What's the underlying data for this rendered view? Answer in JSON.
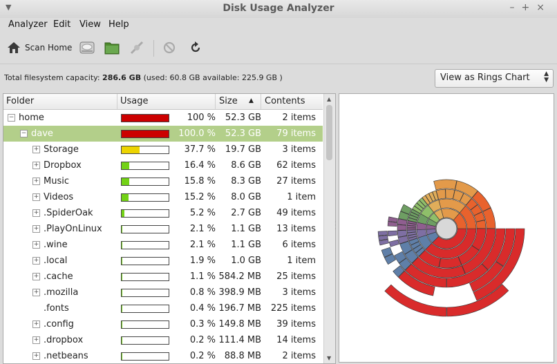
{
  "window": {
    "title": "Disk Usage Analyzer"
  },
  "menu": [
    "Analyzer",
    "Edit",
    "View",
    "Help"
  ],
  "toolbar": {
    "scan_home_label": "Scan Home"
  },
  "info": {
    "prefix": "Total filesystem capacity: ",
    "capacity": "286.6 GB",
    "detail": " (used: 60.8 GB available: 225.9 GB )"
  },
  "view_combo": {
    "selected": "View as Rings Chart"
  },
  "table": {
    "headers": {
      "folder": "Folder",
      "usage": "Usage",
      "size": "Size",
      "contents": "Contents"
    },
    "rows": [
      {
        "name": "home",
        "pct": "100 %",
        "size": "52.3 GB",
        "items": "2 items",
        "usage": 1.0,
        "color": "#cc0000",
        "indent": 0,
        "expander": "minus",
        "selected": false
      },
      {
        "name": "dave",
        "pct": "100.0 %",
        "size": "52.3 GB",
        "items": "79 items",
        "usage": 1.0,
        "color": "#cc0000",
        "indent": 1,
        "expander": "minus",
        "selected": true
      },
      {
        "name": "Storage",
        "pct": "37.7 %",
        "size": "19.7 GB",
        "items": "3 items",
        "usage": 0.377,
        "color": "#edd400",
        "indent": 2,
        "expander": "plus",
        "selected": false
      },
      {
        "name": "Dropbox",
        "pct": "16.4 %",
        "size": "8.6 GB",
        "items": "62 items",
        "usage": 0.164,
        "color": "#73d216",
        "indent": 2,
        "expander": "plus",
        "selected": false
      },
      {
        "name": "Music",
        "pct": "15.8 %",
        "size": "8.3 GB",
        "items": "27 items",
        "usage": 0.158,
        "color": "#73d216",
        "indent": 2,
        "expander": "plus",
        "selected": false
      },
      {
        "name": "Videos",
        "pct": "15.2 %",
        "size": "8.0 GB",
        "items": "1 item",
        "usage": 0.152,
        "color": "#73d216",
        "indent": 2,
        "expander": "plus",
        "selected": false
      },
      {
        "name": ".SpiderOak",
        "pct": "5.2 %",
        "size": "2.7 GB",
        "items": "49 items",
        "usage": 0.052,
        "color": "#73d216",
        "indent": 2,
        "expander": "plus",
        "selected": false
      },
      {
        "name": ".PlayOnLinux",
        "pct": "2.1 %",
        "size": "1.1 GB",
        "items": "13 items",
        "usage": 0.021,
        "color": "#73d216",
        "indent": 2,
        "expander": "plus",
        "selected": false
      },
      {
        "name": ".wine",
        "pct": "2.1 %",
        "size": "1.1 GB",
        "items": "6 items",
        "usage": 0.021,
        "color": "#73d216",
        "indent": 2,
        "expander": "plus",
        "selected": false
      },
      {
        "name": ".local",
        "pct": "1.9 %",
        "size": "1.0 GB",
        "items": "1 item",
        "usage": 0.019,
        "color": "#73d216",
        "indent": 2,
        "expander": "plus",
        "selected": false
      },
      {
        "name": ".cache",
        "pct": "1.1 %",
        "size": "584.2 MB",
        "items": "25 items",
        "usage": 0.011,
        "color": "#73d216",
        "indent": 2,
        "expander": "plus",
        "selected": false
      },
      {
        "name": ".mozilla",
        "pct": "0.8 %",
        "size": "398.9 MB",
        "items": "3 items",
        "usage": 0.008,
        "color": "#73d216",
        "indent": 2,
        "expander": "plus",
        "selected": false
      },
      {
        "name": ".fonts",
        "pct": "0.4 %",
        "size": "196.7 MB",
        "items": "225 items",
        "usage": 0.004,
        "color": "#73d216",
        "indent": 2,
        "expander": "none",
        "selected": false
      },
      {
        "name": ".config",
        "pct": "0.3 %",
        "size": "149.8 MB",
        "items": "39 items",
        "usage": 0.003,
        "color": "#73d216",
        "indent": 2,
        "expander": "plus",
        "selected": false
      },
      {
        "name": ".dropbox",
        "pct": "0.2 %",
        "size": "111.4 MB",
        "items": "14 items",
        "usage": 0.002,
        "color": "#73d216",
        "indent": 2,
        "expander": "plus",
        "selected": false
      },
      {
        "name": ".netbeans",
        "pct": "0.2 %",
        "size": "88.8 MB",
        "items": "2 items",
        "usage": 0.002,
        "color": "#73d216",
        "indent": 2,
        "expander": "plus",
        "selected": false
      }
    ]
  },
  "colors": {
    "selection": "#b3cf8a",
    "usage_full": "#cc0000",
    "usage_mid": "#edd400",
    "usage_low": "#73d216"
  }
}
